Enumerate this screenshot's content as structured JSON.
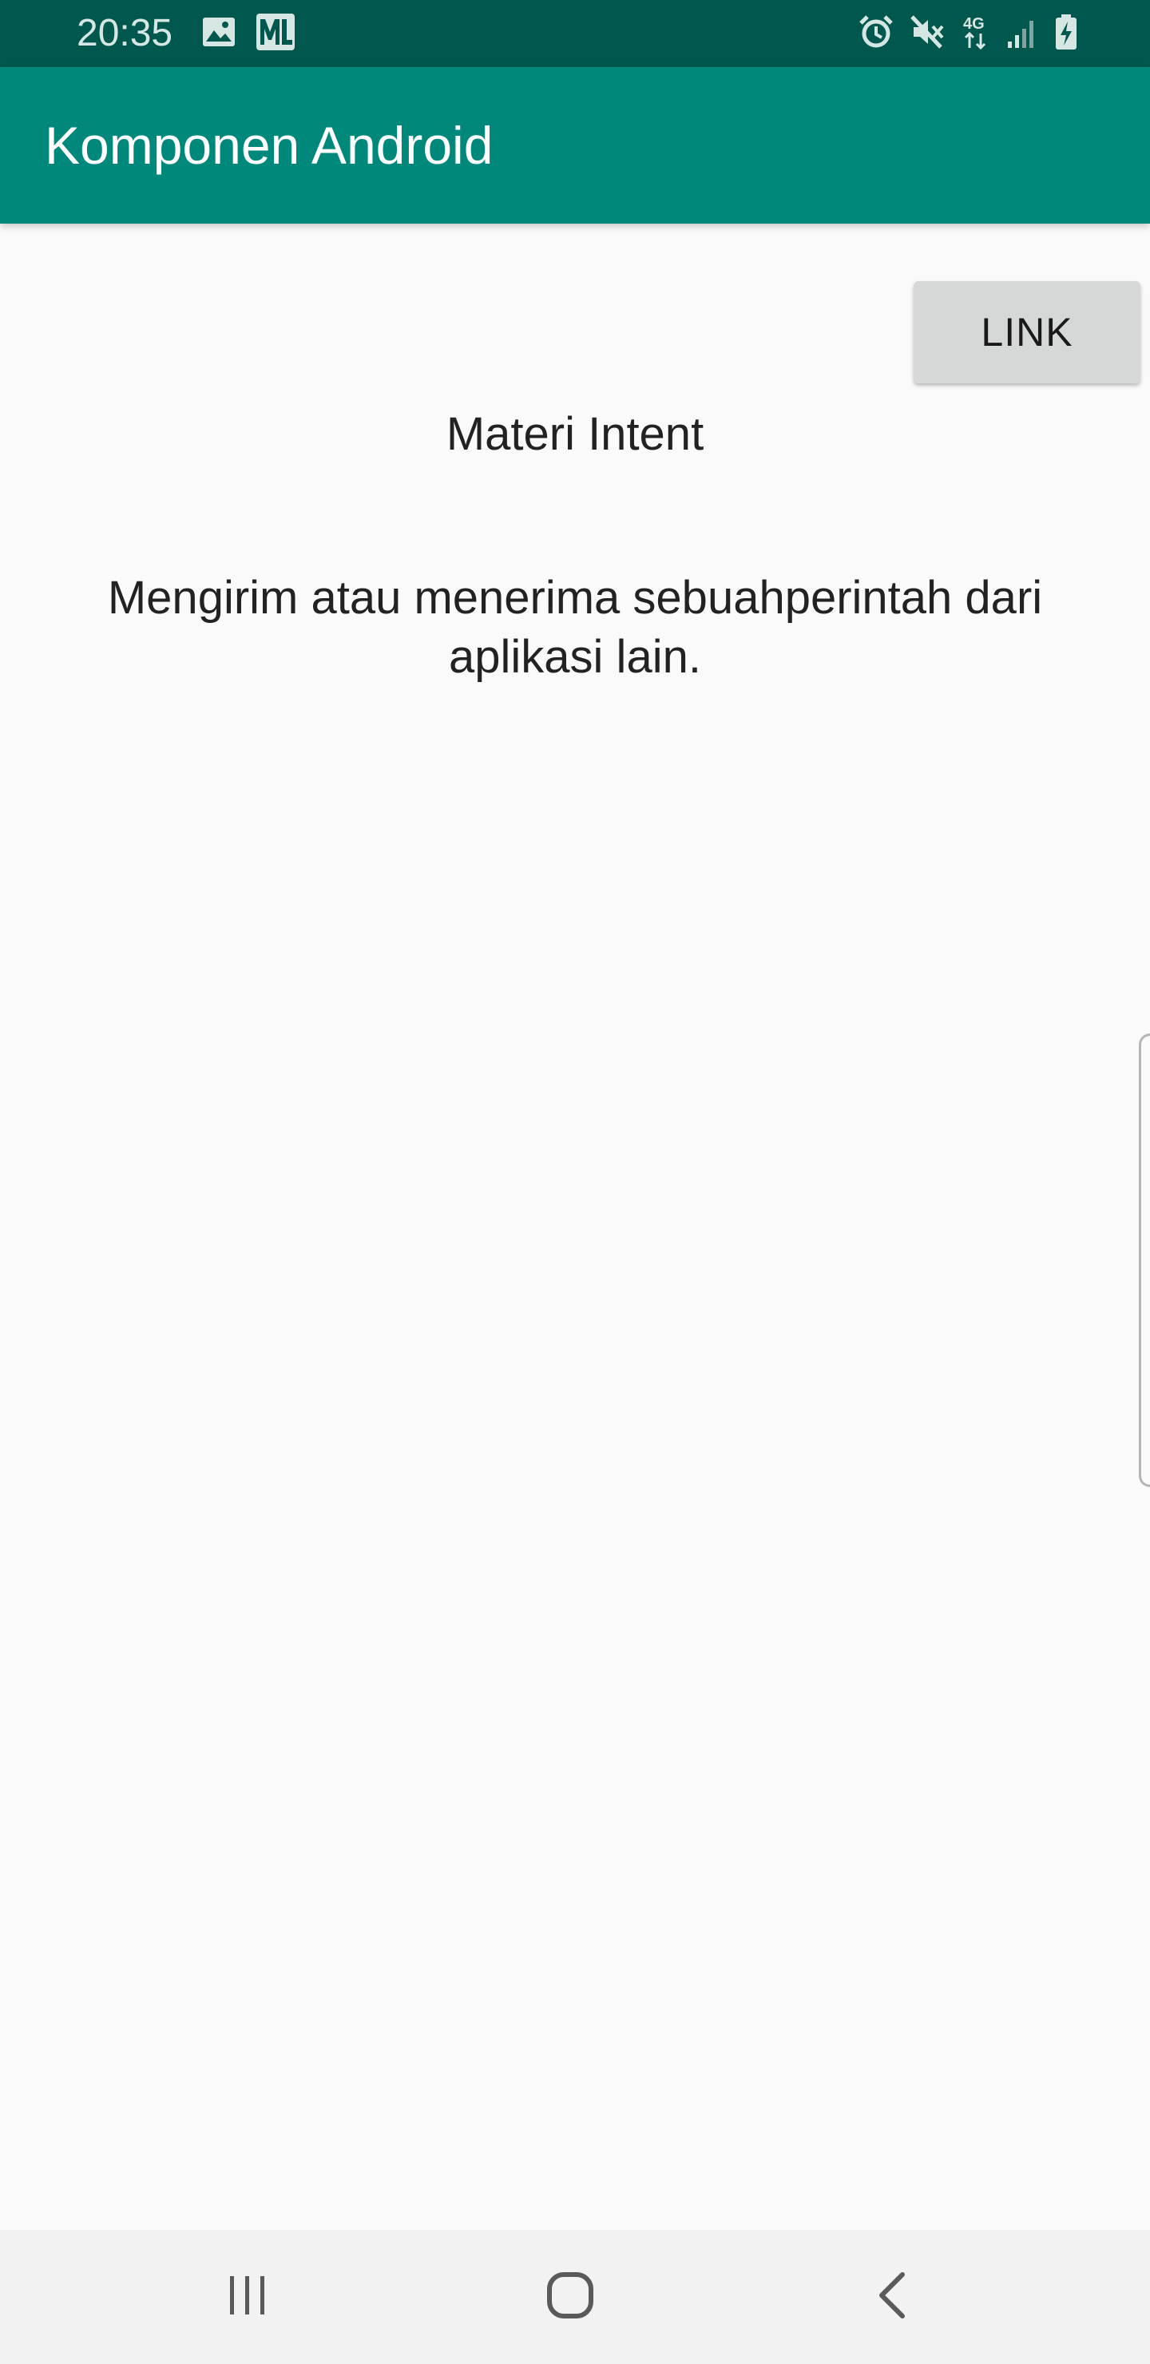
{
  "status_bar": {
    "time": "20:35",
    "left_icons": [
      "image-icon",
      "ml-icon"
    ],
    "right_icons": [
      "alarm-icon",
      "mute-icon",
      "network-4g-icon",
      "signal-icon",
      "battery-charging-icon"
    ],
    "network_label": "4G"
  },
  "app_bar": {
    "title": "Komponen Android",
    "color": "#00897b"
  },
  "content": {
    "link_button_label": "LINK",
    "title": "Materi Intent",
    "description": "Mengirim atau menerima sebuahperintah dari aplikasi lain."
  },
  "nav_bar": {
    "buttons": [
      "recent-apps-icon",
      "home-icon",
      "back-icon"
    ]
  },
  "colors": {
    "status_bar": "#00574e",
    "app_bar": "#00897b",
    "background": "#fafafa",
    "button": "#d6d7d7"
  }
}
